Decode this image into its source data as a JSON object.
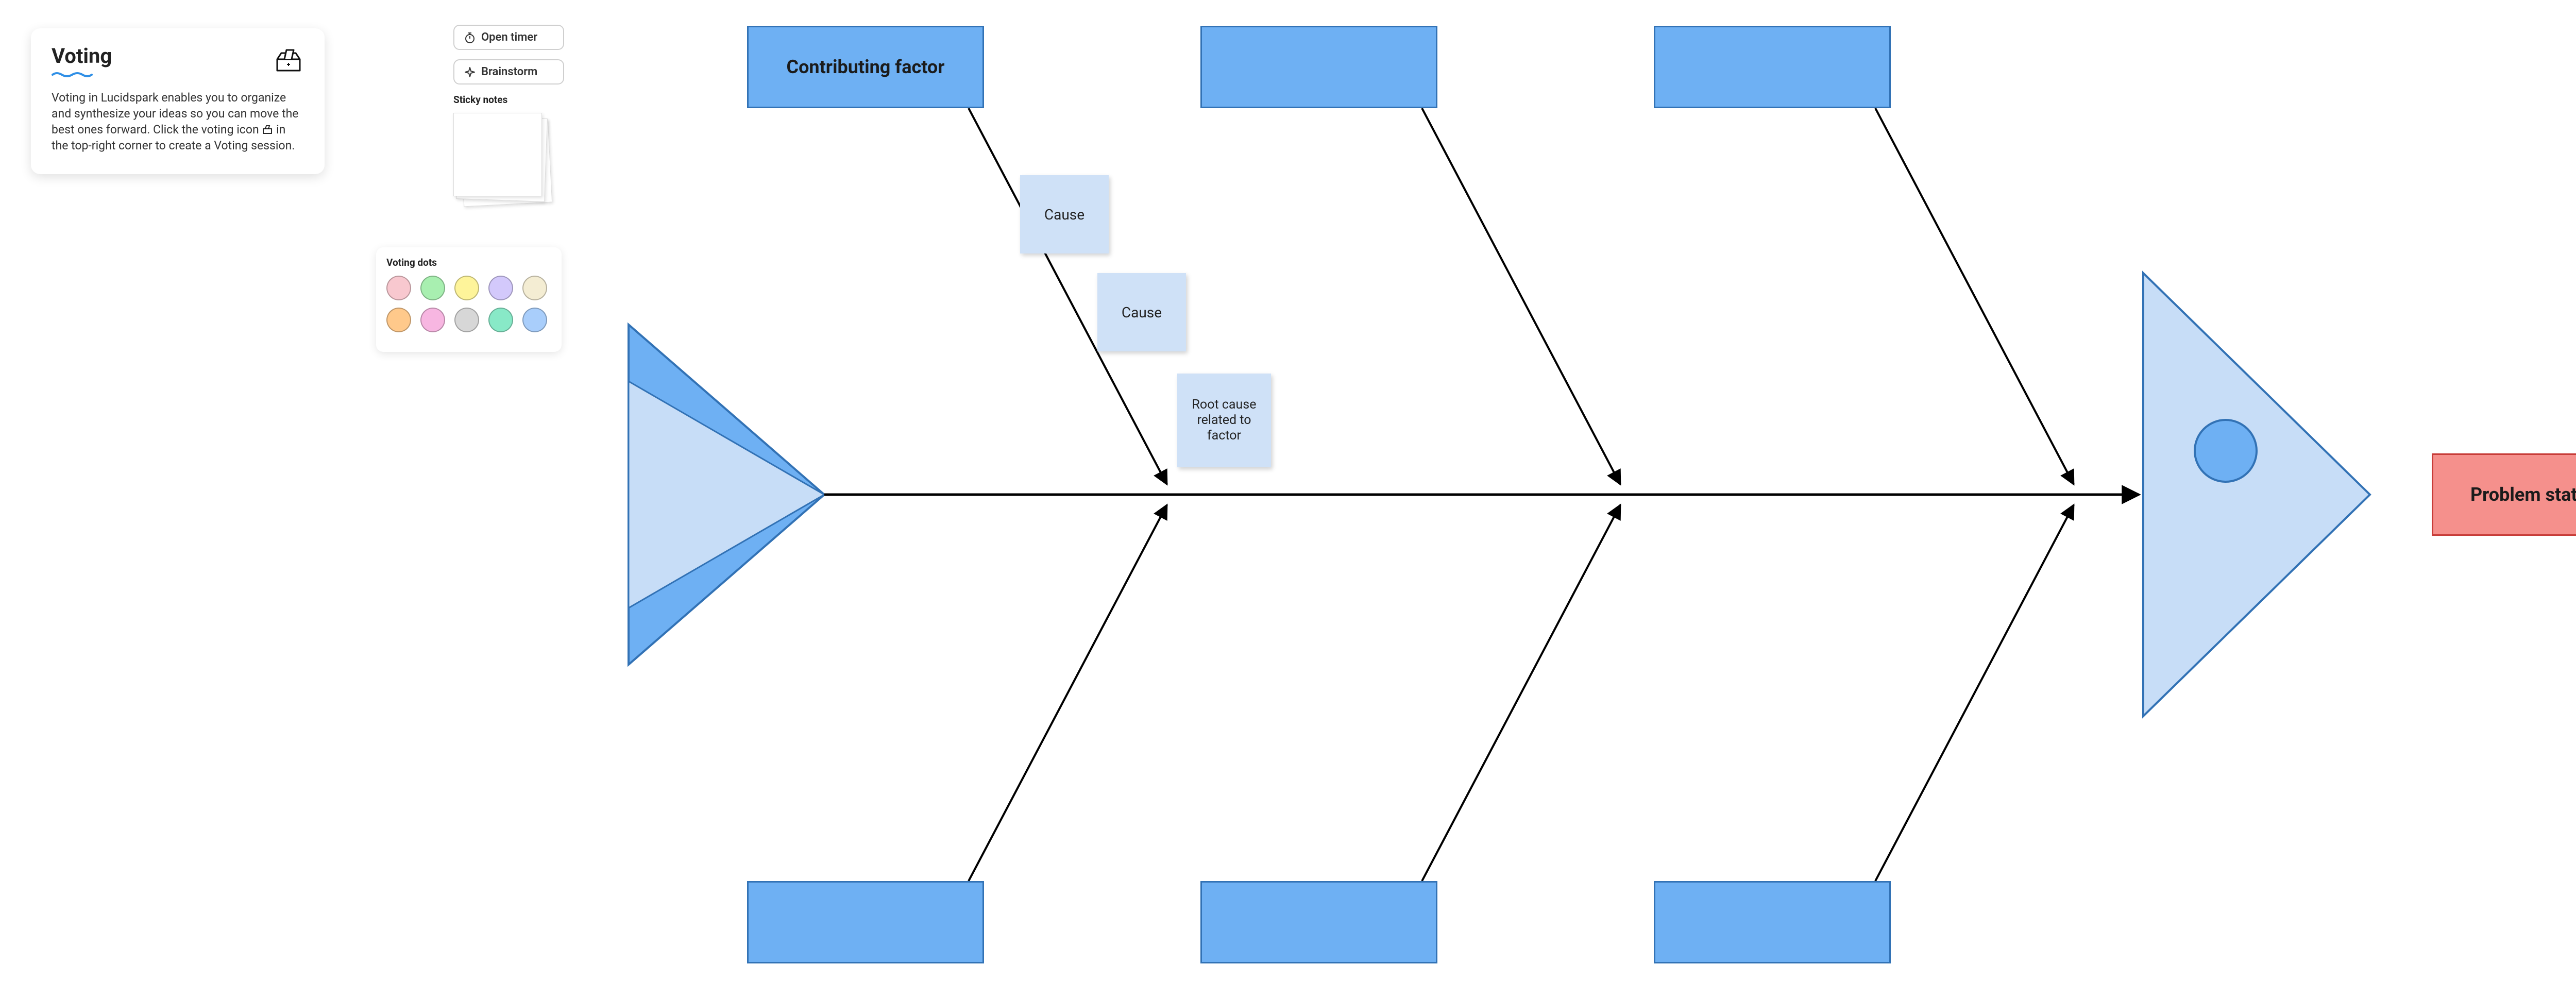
{
  "info_card": {
    "title": "Voting",
    "body_part1": "Voting in Lucidspark enables you to organize and synthesize your ideas so you can move the best ones forward. Click the voting icon ",
    "body_part2": " in the top-right corner to create a Voting session."
  },
  "tool_panel": {
    "open_timer": "Open timer",
    "brainstorm": "Brainstorm",
    "sticky_notes_label": "Sticky notes"
  },
  "voting_dots": {
    "title": "Voting dots",
    "colors_row1": [
      "#f8c8cf",
      "#a8efb0",
      "#fef49a",
      "#d3c9fb",
      "#f4edd3"
    ],
    "colors_row2": [
      "#ffc98b",
      "#f7b6e1",
      "#d7d7d7",
      "#88e9c7",
      "#a9cefb"
    ]
  },
  "diagram": {
    "problem_statement": "Problem statement",
    "factor_label": "Contributing factor",
    "causes": {
      "c1": "Cause",
      "c2": "Cause",
      "c3": "Root cause related to factor"
    },
    "colors": {
      "factor_fill": "#6eb0f3",
      "factor_stroke": "#3272b5",
      "problem_fill": "#f5908c",
      "problem_stroke": "#c73c38",
      "fish_tail_outer": "#6eb0f3",
      "fish_tail_inner": "#c7ddf7",
      "fish_head_fill": "#c7ddf7",
      "fish_head_stroke": "#3272b5",
      "fish_eye": "#6eb0f3"
    }
  }
}
